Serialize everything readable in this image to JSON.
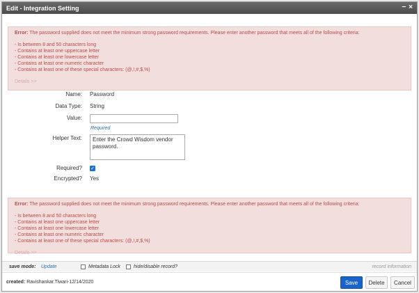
{
  "window": {
    "title": "Edit - Integration Setting",
    "minimize_glyph": "−",
    "close_glyph": "×"
  },
  "error": {
    "prefix": "Error:",
    "message": " The password supplied does not meet the minimum strong password requirements. Please enter another password that meets all of the following criteria:",
    "criteria": [
      "- Is between 8 and 50 characters long",
      "- Contains at least one uppercase letter",
      "- Contains at least one lowercase letter",
      "- Contains at least one numeric character",
      "- Contains at least one of these special characters: (@,!,#,$,%)"
    ],
    "details_link": "Details >>"
  },
  "form": {
    "name_label": "Name:",
    "name_value": "Password",
    "datatype_label": "Data Type:",
    "datatype_value": "String",
    "value_label": "Value:",
    "value_input": "",
    "required_note": "Required",
    "helper_label": "Helper Text:",
    "helper_value": "Enter the Crowd Wisdom vendor password.",
    "required_label": "Required?",
    "required_checked": true,
    "encrypted_label": "Encrypted?",
    "encrypted_value": "Yes"
  },
  "savebar": {
    "mode_label": "save mode:",
    "mode_value": "Update",
    "metadata_lock": "Metadata Lock",
    "hide_disable": "hide/disable record?",
    "record_info": "record information"
  },
  "footer": {
    "created_label": "created:",
    "created_value": "Ravishankar.Tiwari-12/14/2020",
    "save": "Save",
    "delete": "Delete",
    "cancel": "Cancel"
  },
  "colors": {
    "primary_button": "#1a63c8",
    "error_bg": "#f2dedd",
    "error_text": "#b94a48",
    "link": "#2a6db3"
  }
}
